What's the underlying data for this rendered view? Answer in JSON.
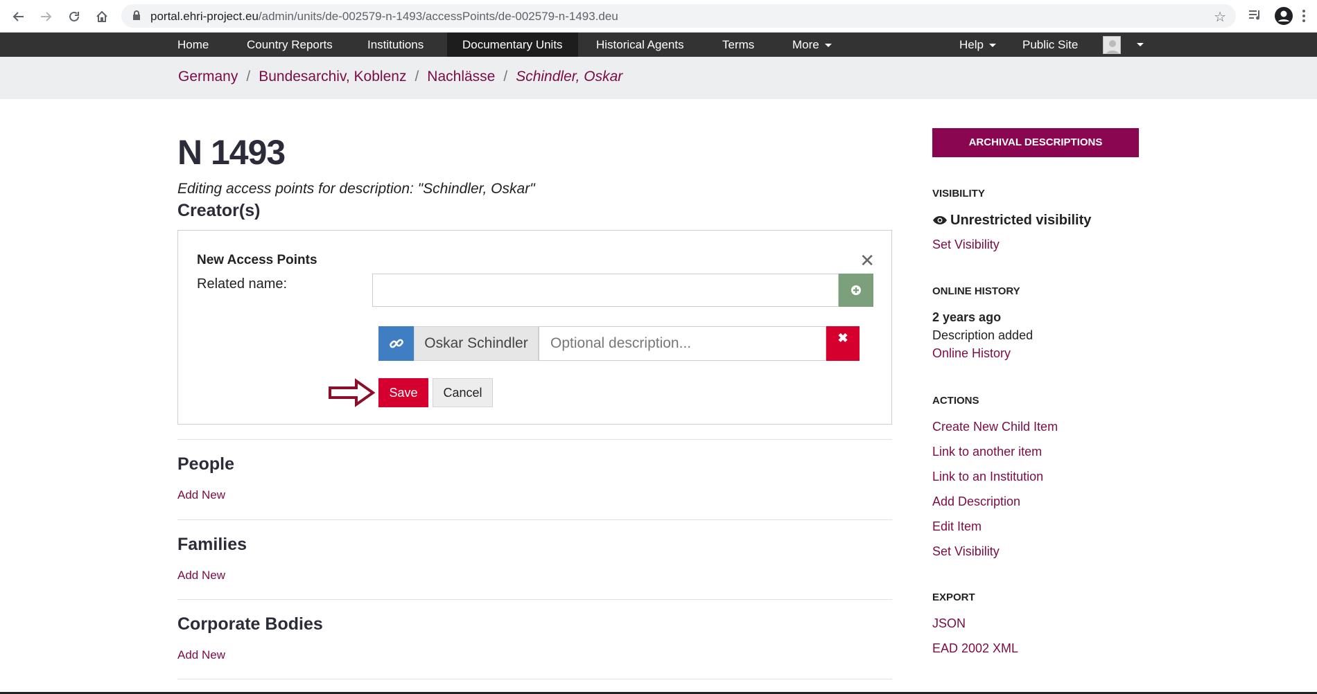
{
  "browser": {
    "url_host": "portal.ehri-project.eu",
    "url_path": "/admin/units/de-002579-n-1493/accessPoints/de-002579-n-1493.deu"
  },
  "topnav": {
    "items": [
      "Home",
      "Country Reports",
      "Institutions",
      "Documentary Units",
      "Historical Agents",
      "Terms",
      "More"
    ],
    "help": "Help",
    "public_site": "Public Site"
  },
  "breadcrumb": [
    "Germany",
    "Bundesarchiv, Koblenz",
    "Nachlässe",
    "Schindler, Oskar"
  ],
  "main": {
    "title": "N 1493",
    "subtitle": "Editing access points for description: \"Schindler, Oskar\"",
    "creators_heading": "Creator(s)",
    "panel": {
      "title": "New Access Points",
      "related_label": "Related name:",
      "related_value": "",
      "access_point_name": "Oskar Schindler",
      "description_placeholder": "Optional description...",
      "save_label": "Save",
      "cancel_label": "Cancel"
    },
    "sections": [
      {
        "heading": "People",
        "add_label": "Add New"
      },
      {
        "heading": "Families",
        "add_label": "Add New"
      },
      {
        "heading": "Corporate Bodies",
        "add_label": "Add New"
      }
    ]
  },
  "sidebar": {
    "button": "ARCHIVAL DESCRIPTIONS",
    "visibility": {
      "heading": "VISIBILITY",
      "status": "Unrestricted visibility",
      "link": "Set Visibility"
    },
    "history": {
      "heading": "ONLINE HISTORY",
      "when": "2 years ago",
      "event": "Description added",
      "link": "Online History"
    },
    "actions": {
      "heading": "ACTIONS",
      "links": [
        "Create New Child Item",
        "Link to another item",
        "Link to an Institution",
        "Add Description",
        "Edit Item",
        "Set Visibility"
      ]
    },
    "export": {
      "heading": "EXPORT",
      "links": [
        "JSON",
        "EAD 2002 XML"
      ]
    }
  },
  "colors": {
    "brand": "#8b0650",
    "link": "#7a0c45",
    "danger": "#d6002e",
    "nav": "#333333"
  }
}
